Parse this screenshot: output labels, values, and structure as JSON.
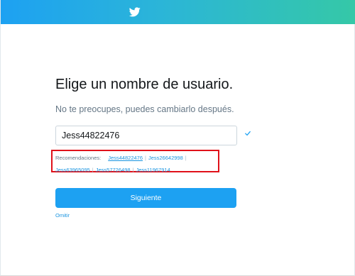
{
  "header": {
    "logo_icon": "twitter-bird-icon",
    "gradient_start": "#1da1f2",
    "gradient_end": "#35c8a7"
  },
  "main": {
    "title": "Elige un nombre de usuario.",
    "subtitle": "No te preocupes, puedes cambiarlo después.",
    "username_value": "Jess44822476",
    "valid_icon": "checkmark-icon",
    "recommendations_label": "Recomendaciones:",
    "recommendations": [
      "Jess44822476",
      "Jess26642998",
      "Jess63965095",
      "Jess57726498",
      "Jess11967914"
    ],
    "separator": "|",
    "next_button_label": "Siguiente",
    "skip_label": "Omitir"
  },
  "colors": {
    "accent": "#1da1f2",
    "link": "#1b95e0",
    "highlight_box": "#e0111a"
  }
}
